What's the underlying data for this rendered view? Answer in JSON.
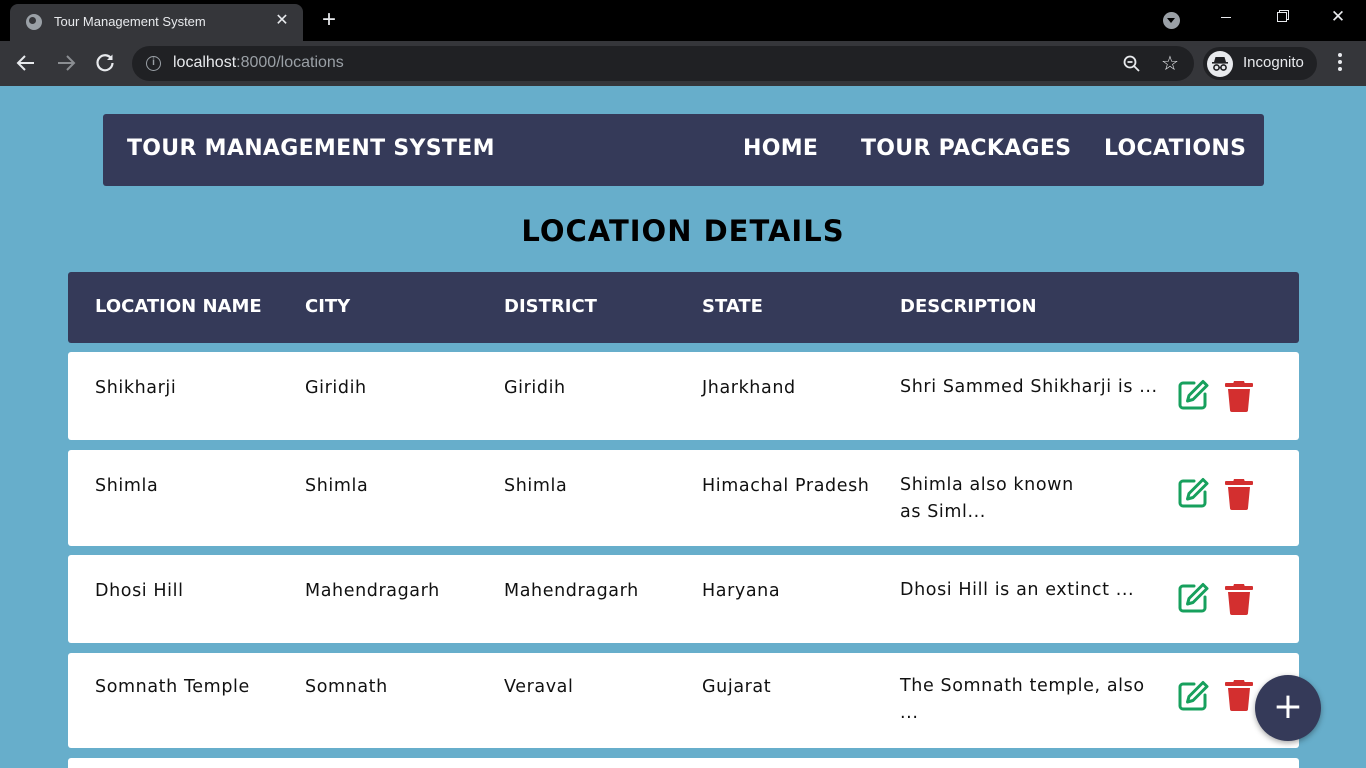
{
  "browser": {
    "tab_title": "Tour Management System",
    "url_host": "localhost",
    "url_rest": ":8000/locations",
    "profile_label": "Incognito"
  },
  "navbar": {
    "brand": "TOUR MANAGEMENT SYSTEM",
    "links": [
      "HOME",
      "TOUR PACKAGES",
      "LOCATIONS"
    ]
  },
  "page": {
    "heading": "LOCATION DETAILS"
  },
  "table": {
    "columns": [
      "LOCATION NAME",
      "CITY",
      "DISTRICT",
      "STATE",
      "DESCRIPTION"
    ],
    "rows": [
      {
        "name": "Shikharji",
        "city": "Giridih",
        "district": "Giridih",
        "state": "Jharkhand",
        "description": "Shri Sammed Shikharji is ..."
      },
      {
        "name": "Shimla",
        "city": "Shimla",
        "district": "Shimla",
        "state": "Himachal Pradesh",
        "description": "Shimla also known as Siml..."
      },
      {
        "name": "Dhosi Hill",
        "city": "Mahendragarh",
        "district": "Mahendragarh",
        "state": "Haryana",
        "description": "Dhosi Hill is an extinct ..."
      },
      {
        "name": "Somnath Temple",
        "city": "Somnath",
        "district": "Veraval",
        "state": "Gujarat",
        "description": "The Somnath temple, also ..."
      }
    ]
  },
  "colors": {
    "page_background": "#67aecb",
    "navy": "#353a59",
    "edit_green": "#17a05d",
    "delete_red": "#d32f2f"
  },
  "fab": {
    "icon": "plus-icon"
  }
}
